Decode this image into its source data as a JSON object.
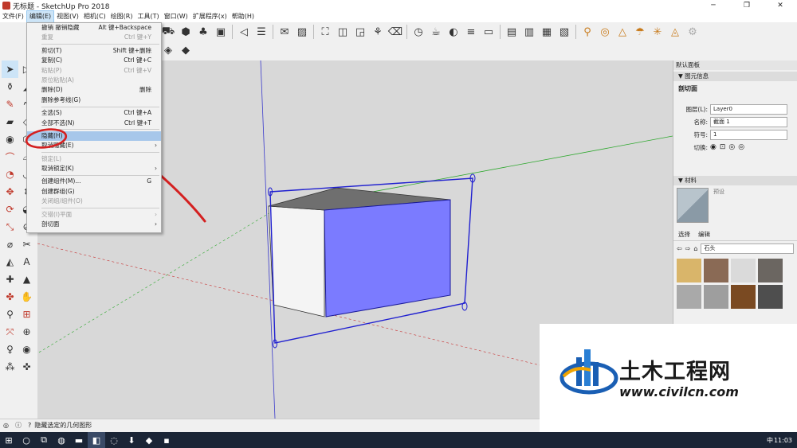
{
  "window": {
    "title": "无标题 - SketchUp Pro 2018",
    "minimize": "─",
    "maximize": "❐",
    "close": "✕"
  },
  "menubar": [
    "文件(F)",
    "编辑(E)",
    "视图(V)",
    "相机(C)",
    "绘图(R)",
    "工具(T)",
    "窗口(W)",
    "扩展程序(x)",
    "帮助(H)"
  ],
  "edit_menu": {
    "undo": {
      "label": "撤销 撤销隐藏",
      "shortcut": "Alt 键+Backspace"
    },
    "redo": {
      "label": "重复",
      "shortcut": "Ctrl 键+Y"
    },
    "cut": {
      "label": "剪切(T)",
      "shortcut": "Shift 键+删除"
    },
    "copy": {
      "label": "复制(C)",
      "shortcut": "Ctrl 键+C"
    },
    "paste": {
      "label": "粘贴(P)",
      "shortcut": "Ctrl 键+V"
    },
    "paste_in_place": {
      "label": "原位粘贴(A)"
    },
    "delete": {
      "label": "删除(D)",
      "shortcut": "删除"
    },
    "delete_guides": {
      "label": "删除参考线(G)"
    },
    "select_all": {
      "label": "全选(S)",
      "shortcut": "Ctrl 键+A"
    },
    "select_none": {
      "label": "全部不选(N)",
      "shortcut": "Ctrl 键+T"
    },
    "hide": {
      "label": "隐藏(H)"
    },
    "unhide": {
      "label": "取消隐藏(E)"
    },
    "lock": {
      "label": "锁定(L)"
    },
    "unlock": {
      "label": "取消锁定(K)"
    },
    "make_component": {
      "label": "创建组件(M)...",
      "shortcut": "G"
    },
    "make_group": {
      "label": "创建群组(G)"
    },
    "close_group": {
      "label": "关闭组/组件(O)"
    },
    "intersect_faces": {
      "label": "交错(I)平面"
    },
    "section_plane": {
      "label": "剖切面"
    }
  },
  "panel": {
    "tray_title": "默认面板",
    "entity_info": {
      "header": "图元信息",
      "type": "剖切面",
      "layer_label": "图层(L):",
      "layer_value": "Layer0",
      "name_label": "名称:",
      "name_value": "截面 1",
      "symbol_label": "符号:",
      "symbol_value": "1",
      "toggle_label": "切换:"
    },
    "materials": {
      "header": "材料",
      "preview_label": "预设",
      "tab_select": "选择",
      "tab_edit": "编辑",
      "library": "石头",
      "swatches": [
        "#d9b56a",
        "#8a6a55",
        "#dadada",
        "#6b6661",
        "#a9a9a9",
        "#9e9e9e",
        "#7a4a22",
        "#4e4e4e"
      ]
    }
  },
  "statusbar": {
    "message": "隐藏选定的几何图形"
  },
  "taskbar": {
    "time": "11:03",
    "ime": "中"
  },
  "watermark": {
    "cn": "土木工程网",
    "url": "www.civilcn.com"
  },
  "colors": {
    "section_plane": "#2020d0",
    "selected_face": "#7b7bff",
    "highlight": "#a7c7ea",
    "annotation": "#d42020"
  }
}
